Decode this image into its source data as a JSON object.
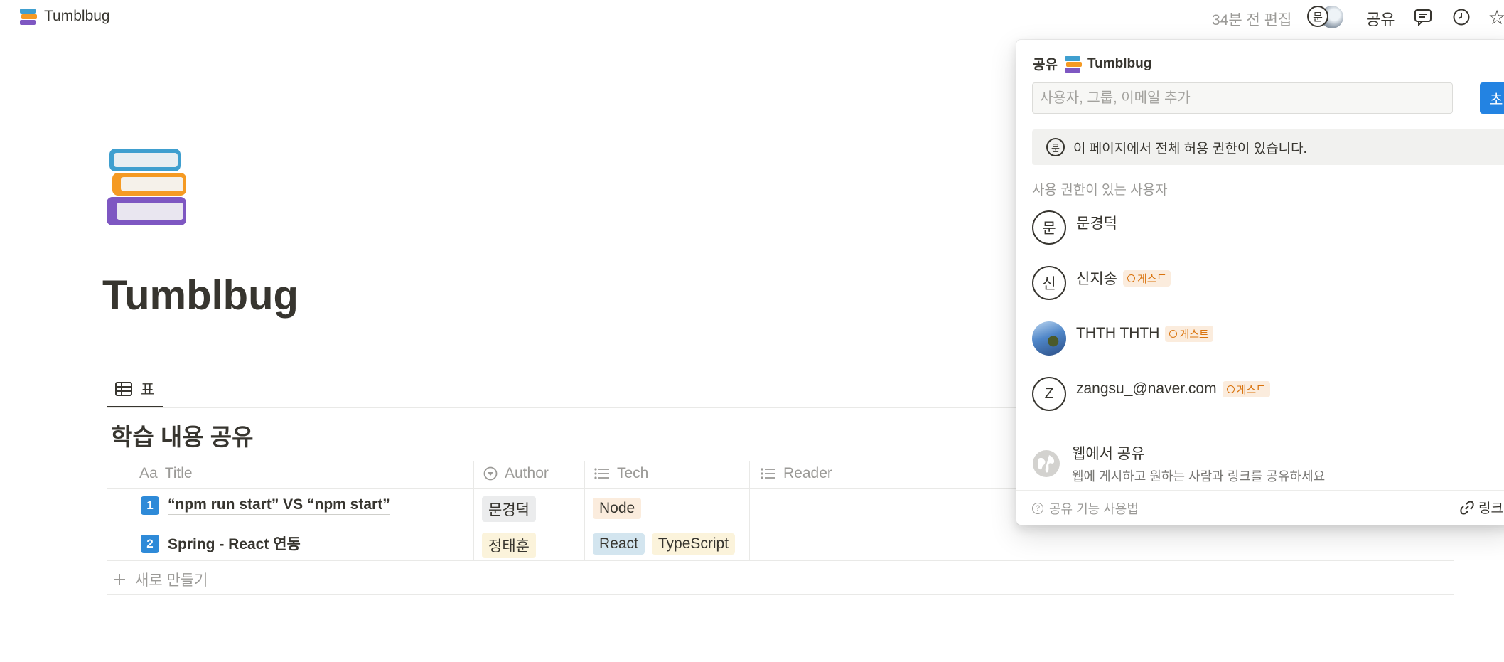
{
  "topbar": {
    "breadcrumb": "Tumblbug",
    "edited": "34분 전 편집",
    "avatar_initial": "문",
    "share_label": "공유"
  },
  "page": {
    "title": "Tumblbug",
    "view_tab": "표",
    "db_title": "학습 내용 공유",
    "columns": {
      "title": "Title",
      "title_prefix": "Aa",
      "author": "Author",
      "tech": "Tech",
      "reader": "Reader"
    },
    "rows": [
      {
        "num": "1",
        "title": "“npm run start” VS “npm start”",
        "author": "문경덕",
        "tech": [
          "Node"
        ]
      },
      {
        "num": "2",
        "title": "Spring - React 연동",
        "author": "정태훈",
        "tech": [
          "React",
          "TypeScript"
        ]
      }
    ],
    "new_row": "새로 만들기"
  },
  "share_popover": {
    "header_prefix": "공유",
    "header_page": "Tumblbug",
    "input_placeholder": "사용자, 그룹, 이메일 추가",
    "invite_button": "초",
    "notice_initial": "문",
    "notice": "이 페이지에서 전체 허용 권한이 있습니다.",
    "section_label": "사용 권한이 있는 사용자",
    "guest_label": "게스트",
    "users": [
      {
        "initial": "문",
        "name": "문경덕"
      },
      {
        "initial": "신",
        "name": "신지송"
      },
      {
        "initial": "",
        "name": "THTH THTH"
      },
      {
        "initial": "Z",
        "name": "zangsu_@naver.com"
      }
    ],
    "web_share_title": "웹에서 공유",
    "web_share_desc": "웹에 게시하고 원하는 사람과 링크를 공유하세요",
    "help": "공유 기능 사용법",
    "help_icon": "?",
    "copy_link": "링크"
  }
}
